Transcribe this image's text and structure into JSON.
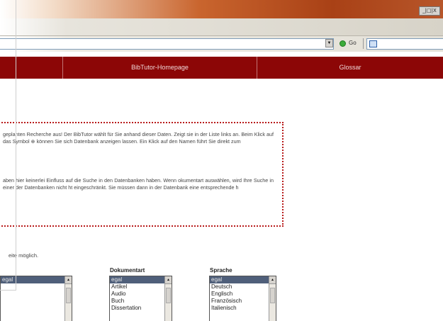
{
  "window": {
    "controls_label": "_|□|X"
  },
  "addressbar": {
    "dropdown_glyph": "▼",
    "go_label": "Go",
    "links_label": ""
  },
  "nav": {
    "items": [
      {
        "label": ""
      },
      {
        "label": "BibTutor-Homepage"
      },
      {
        "label": "Glossar"
      }
    ]
  },
  "info": {
    "paragraph1": "geplanten Recherche aus! Der BibTutor wählt für Sie anhand dieser Daten. Zeigt sie in der Liste links an. Beim Klick auf das Symbol ⊕ können Sie sich Datenbank anzeigen lassen. Ein Klick auf den Namen führt Sie direkt zum",
    "paragraph2": "aben hier keinerlei Einfluss auf die Suche in den Datenbanken haben. Wenn okumentart auswählen, wird Ihre Suche in einer der Datenbanken nicht ht eingeschränkt. Sie müssen dann in der Datenbank eine entsprechende h"
  },
  "hint": "eite möglich.",
  "selects": {
    "first": {
      "title": "",
      "options": [
        "egal"
      ]
    },
    "dokumentart": {
      "title": "Dokumentart",
      "options": [
        "egal",
        "Artikel",
        "Audio",
        "Buch",
        "Dissertation"
      ]
    },
    "sprache": {
      "title": "Sprache",
      "options": [
        "egal",
        "Deutsch",
        "Englisch",
        "Französisch",
        "Italienisch"
      ]
    }
  },
  "colors": {
    "nav_bg": "#8c0606",
    "titlebar_accent": "#a94116",
    "border_dotted": "#b81b1b",
    "selected_option": "#4f5f7a"
  }
}
